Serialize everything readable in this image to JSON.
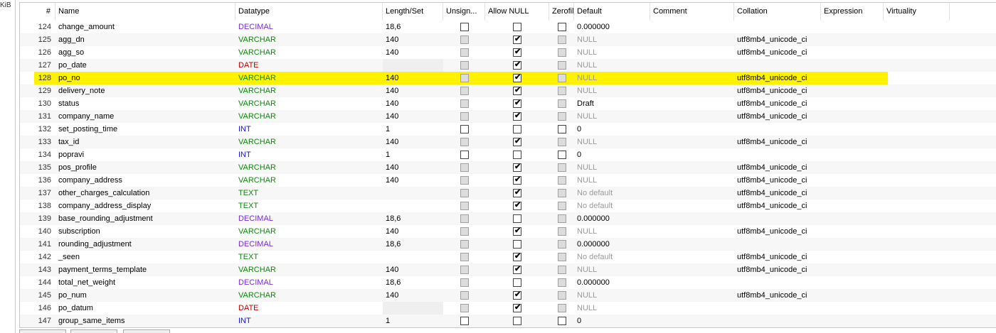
{
  "gutter": {
    "label": "KiB"
  },
  "columns": {
    "num": "#",
    "name": "Name",
    "datatype": "Datatype",
    "length": "Length/Set",
    "unsigned": "Unsign...",
    "allow_null": "Allow NULL",
    "zerofill": "Zerofill",
    "default": "Default",
    "comment": "Comment",
    "collation": "Collation",
    "expression": "Expression",
    "virtuality": "Virtuality"
  },
  "colors": {
    "highlight": "#fef200",
    "varchar": "#0c8a0c",
    "decimal": "#7b2be0",
    "int": "#1414e6",
    "date": "#c00000",
    "text": "#0c8a0c"
  },
  "selected_row": 128,
  "rows": [
    {
      "num": "124",
      "name": "change_amount",
      "type": "DECIMAL",
      "len": "18,6",
      "unsigned": false,
      "unsigned_dis": false,
      "null": false,
      "zerofill": false,
      "zerofill_dis": false,
      "default": "0.000000",
      "default_gray": false,
      "collation": ""
    },
    {
      "num": "125",
      "name": "agg_dn",
      "type": "VARCHAR",
      "len": "140",
      "unsigned": false,
      "unsigned_dis": true,
      "null": true,
      "zerofill": false,
      "zerofill_dis": true,
      "default": "NULL",
      "default_gray": true,
      "collation": "utf8mb4_unicode_ci"
    },
    {
      "num": "126",
      "name": "agg_so",
      "type": "VARCHAR",
      "len": "140",
      "unsigned": false,
      "unsigned_dis": true,
      "null": true,
      "zerofill": false,
      "zerofill_dis": true,
      "default": "NULL",
      "default_gray": true,
      "collation": "utf8mb4_unicode_ci"
    },
    {
      "num": "127",
      "name": "po_date",
      "type": "DATE",
      "len": "",
      "len_gray": true,
      "unsigned": false,
      "unsigned_dis": true,
      "null": true,
      "zerofill": false,
      "zerofill_dis": true,
      "default": "NULL",
      "default_gray": true,
      "collation": ""
    },
    {
      "num": "128",
      "name": "po_no",
      "type": "VARCHAR",
      "len": "140",
      "unsigned": false,
      "unsigned_dis": true,
      "null": true,
      "zerofill": false,
      "zerofill_dis": true,
      "default": "NULL",
      "default_gray": true,
      "collation": "utf8mb4_unicode_ci"
    },
    {
      "num": "129",
      "name": "delivery_note",
      "type": "VARCHAR",
      "len": "140",
      "unsigned": false,
      "unsigned_dis": true,
      "null": true,
      "zerofill": false,
      "zerofill_dis": true,
      "default": "NULL",
      "default_gray": true,
      "collation": "utf8mb4_unicode_ci"
    },
    {
      "num": "130",
      "name": "status",
      "type": "VARCHAR",
      "len": "140",
      "unsigned": false,
      "unsigned_dis": true,
      "null": true,
      "zerofill": false,
      "zerofill_dis": true,
      "default": "Draft",
      "default_gray": false,
      "collation": "utf8mb4_unicode_ci"
    },
    {
      "num": "131",
      "name": "company_name",
      "type": "VARCHAR",
      "len": "140",
      "unsigned": false,
      "unsigned_dis": true,
      "null": true,
      "zerofill": false,
      "zerofill_dis": true,
      "default": "NULL",
      "default_gray": true,
      "collation": "utf8mb4_unicode_ci"
    },
    {
      "num": "132",
      "name": "set_posting_time",
      "type": "INT",
      "len": "1",
      "unsigned": false,
      "unsigned_dis": false,
      "null": false,
      "zerofill": false,
      "zerofill_dis": false,
      "default": "0",
      "default_gray": false,
      "collation": ""
    },
    {
      "num": "133",
      "name": "tax_id",
      "type": "VARCHAR",
      "len": "140",
      "unsigned": false,
      "unsigned_dis": true,
      "null": true,
      "zerofill": false,
      "zerofill_dis": true,
      "default": "NULL",
      "default_gray": true,
      "collation": "utf8mb4_unicode_ci"
    },
    {
      "num": "134",
      "name": "popravi",
      "type": "INT",
      "len": "1",
      "unsigned": false,
      "unsigned_dis": false,
      "null": false,
      "zerofill": false,
      "zerofill_dis": false,
      "default": "0",
      "default_gray": false,
      "collation": ""
    },
    {
      "num": "135",
      "name": "pos_profile",
      "type": "VARCHAR",
      "len": "140",
      "unsigned": false,
      "unsigned_dis": true,
      "null": true,
      "zerofill": false,
      "zerofill_dis": true,
      "default": "NULL",
      "default_gray": true,
      "collation": "utf8mb4_unicode_ci"
    },
    {
      "num": "136",
      "name": "company_address",
      "type": "VARCHAR",
      "len": "140",
      "unsigned": false,
      "unsigned_dis": true,
      "null": true,
      "zerofill": false,
      "zerofill_dis": true,
      "default": "NULL",
      "default_gray": true,
      "collation": "utf8mb4_unicode_ci"
    },
    {
      "num": "137",
      "name": "other_charges_calculation",
      "type": "TEXT",
      "len": "",
      "unsigned": false,
      "unsigned_dis": true,
      "null": true,
      "zerofill": false,
      "zerofill_dis": true,
      "default": "No default",
      "default_gray": true,
      "collation": "utf8mb4_unicode_ci"
    },
    {
      "num": "138",
      "name": "company_address_display",
      "type": "TEXT",
      "len": "",
      "unsigned": false,
      "unsigned_dis": true,
      "null": true,
      "zerofill": false,
      "zerofill_dis": true,
      "default": "No default",
      "default_gray": true,
      "collation": "utf8mb4_unicode_ci"
    },
    {
      "num": "139",
      "name": "base_rounding_adjustment",
      "type": "DECIMAL",
      "len": "18,6",
      "unsigned": false,
      "unsigned_dis": true,
      "null": false,
      "zerofill": false,
      "zerofill_dis": true,
      "default": "0.000000",
      "default_gray": false,
      "collation": ""
    },
    {
      "num": "140",
      "name": "subscription",
      "type": "VARCHAR",
      "len": "140",
      "unsigned": false,
      "unsigned_dis": true,
      "null": true,
      "zerofill": false,
      "zerofill_dis": true,
      "default": "NULL",
      "default_gray": true,
      "collation": "utf8mb4_unicode_ci"
    },
    {
      "num": "141",
      "name": "rounding_adjustment",
      "type": "DECIMAL",
      "len": "18,6",
      "unsigned": false,
      "unsigned_dis": true,
      "null": false,
      "zerofill": false,
      "zerofill_dis": true,
      "default": "0.000000",
      "default_gray": false,
      "collation": ""
    },
    {
      "num": "142",
      "name": "_seen",
      "type": "TEXT",
      "len": "",
      "unsigned": false,
      "unsigned_dis": true,
      "null": true,
      "zerofill": false,
      "zerofill_dis": true,
      "default": "No default",
      "default_gray": true,
      "collation": "utf8mb4_unicode_ci"
    },
    {
      "num": "143",
      "name": "payment_terms_template",
      "type": "VARCHAR",
      "len": "140",
      "unsigned": false,
      "unsigned_dis": true,
      "null": true,
      "zerofill": false,
      "zerofill_dis": true,
      "default": "NULL",
      "default_gray": true,
      "collation": "utf8mb4_unicode_ci"
    },
    {
      "num": "144",
      "name": "total_net_weight",
      "type": "DECIMAL",
      "len": "18,6",
      "unsigned": false,
      "unsigned_dis": true,
      "null": false,
      "zerofill": false,
      "zerofill_dis": true,
      "default": "0.000000",
      "default_gray": false,
      "collation": ""
    },
    {
      "num": "145",
      "name": "po_num",
      "type": "VARCHAR",
      "len": "140",
      "unsigned": false,
      "unsigned_dis": true,
      "null": true,
      "zerofill": false,
      "zerofill_dis": true,
      "default": "NULL",
      "default_gray": true,
      "collation": "utf8mb4_unicode_ci"
    },
    {
      "num": "146",
      "name": "po_datum",
      "type": "DATE",
      "len": "",
      "len_gray": true,
      "unsigned": false,
      "unsigned_dis": true,
      "null": true,
      "zerofill": false,
      "zerofill_dis": true,
      "default": "NULL",
      "default_gray": true,
      "collation": ""
    },
    {
      "num": "147",
      "name": "group_same_items",
      "type": "INT",
      "len": "1",
      "unsigned": false,
      "unsigned_dis": false,
      "null": false,
      "zerofill": false,
      "zerofill_dis": false,
      "default": "0",
      "default_gray": false,
      "collation": ""
    }
  ]
}
